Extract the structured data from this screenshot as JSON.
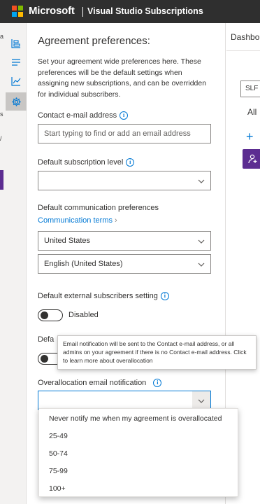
{
  "header": {
    "brand": "Microsoft",
    "product": "Visual Studio Subscriptions"
  },
  "background": {
    "left_fragments": [
      "a",
      "s",
      "/"
    ]
  },
  "rail": {
    "items": [
      {
        "icon": "org-chart-icon",
        "active": false
      },
      {
        "icon": "list-icon",
        "active": false
      },
      {
        "icon": "line-chart-icon",
        "active": false
      },
      {
        "icon": "gear-icon",
        "active": true
      }
    ]
  },
  "panel": {
    "title": "Agreement preferences:",
    "description": "Set your agreement wide preferences here. These preferences will be the default settings when assigning new subscriptions, and can be overridden for individual subscribers.",
    "contact_email": {
      "label": "Contact e-mail address",
      "placeholder": "Start typing to find or add an email address",
      "value": ""
    },
    "subscription_level": {
      "label": "Default subscription level",
      "value": ""
    },
    "communication": {
      "label": "Default communication preferences",
      "link": "Communication terms",
      "country": "United States",
      "language": "English (United States)"
    },
    "external_subscribers": {
      "label": "Default external subscribers setting",
      "toggle_state": "Disabled"
    },
    "obscured_setting": {
      "label": "Defa",
      "toggle_state": "D"
    },
    "overallocation": {
      "label": "Overallocation email notification",
      "value": ""
    }
  },
  "tooltip": {
    "text": "Email notification will be sent to the Contact e-mail address, or all admins on your agreement if there is no Contact e-mail address. Click to learn more about overallocation"
  },
  "dropdown_options": [
    "Never notify me when my agreement is overallocated",
    "25-49",
    "50-74",
    "75-99",
    "100+"
  ],
  "right_pane": {
    "tab": "Dashbo",
    "box_text": "SLF",
    "all_text": "All",
    "plus": "+"
  },
  "colors": {
    "topbar": "#2f2f2f",
    "accent": "#0078d4",
    "purple": "#5c2d91"
  }
}
